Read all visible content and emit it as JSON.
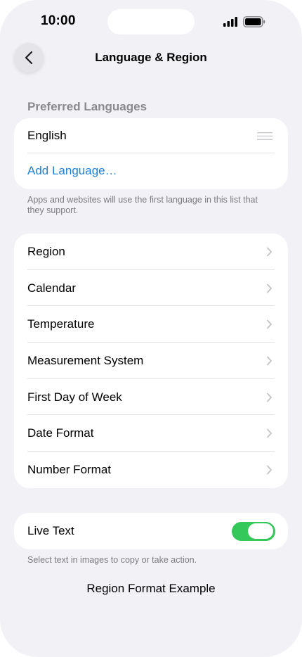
{
  "status_bar": {
    "time": "10:00",
    "icons": [
      "signal-icon",
      "battery-icon"
    ]
  },
  "nav": {
    "title": "Language & Region",
    "back_icon": "chevron-left-icon"
  },
  "preferred_languages": {
    "header": "Preferred Languages",
    "languages": [
      "English"
    ],
    "add_label": "Add Language…",
    "footnote": "Apps and websites will use the first language in this list that they support."
  },
  "settings": {
    "items": [
      {
        "label": "Region"
      },
      {
        "label": "Calendar"
      },
      {
        "label": "Temperature"
      },
      {
        "label": "Measurement System"
      },
      {
        "label": "First Day of Week"
      },
      {
        "label": "Date Format"
      },
      {
        "label": "Number Format"
      }
    ]
  },
  "live_text": {
    "label": "Live Text",
    "enabled": true,
    "footnote": "Select text in images to copy or take action."
  },
  "example_label": "Region Format Example",
  "colors": {
    "background": "#f1f1f6",
    "card": "#ffffff",
    "link": "#1f7fd6",
    "toggle_on": "#34c759",
    "secondary_text": "#8a8a8e"
  }
}
